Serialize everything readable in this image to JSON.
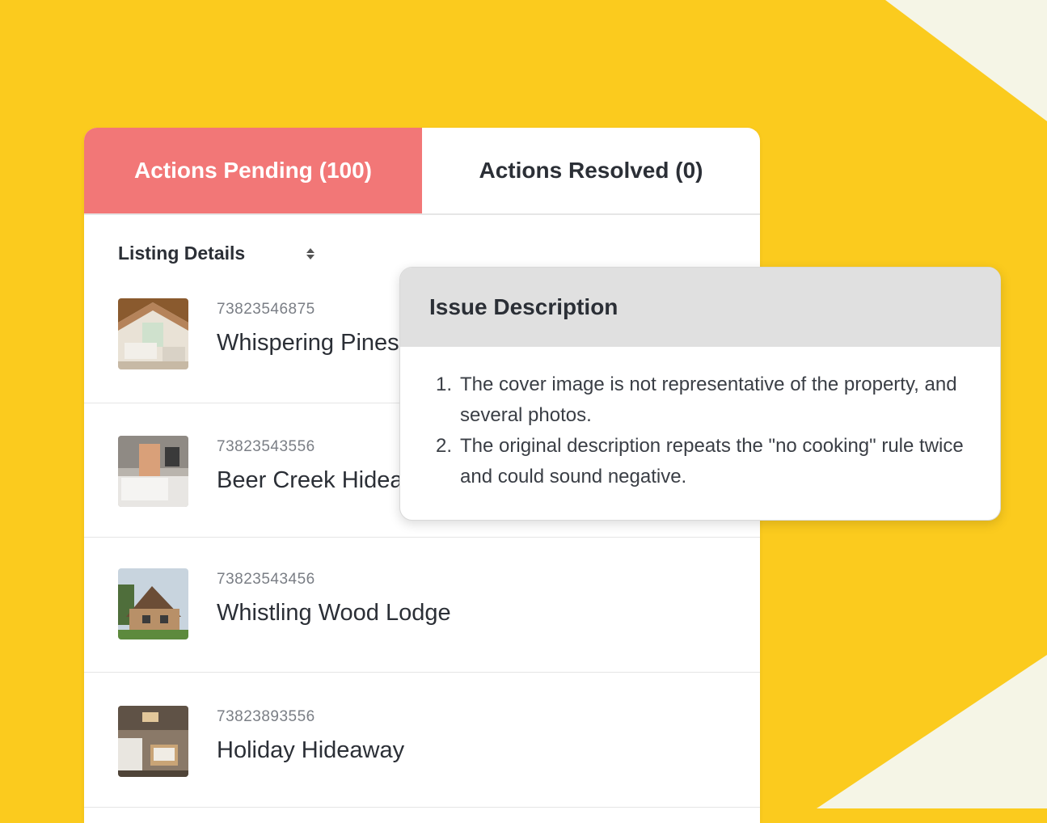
{
  "tabs": {
    "pending": "Actions Pending (100)",
    "resolved": "Actions Resolved (0)"
  },
  "list": {
    "header": "Listing Details",
    "items": [
      {
        "id": "73823546875",
        "name": "Whispering Pines"
      },
      {
        "id": "73823543556",
        "name": "Beer Creek Hidea"
      },
      {
        "id": "73823543456",
        "name": "Whistling Wood Lodge"
      },
      {
        "id": "73823893556",
        "name": "Holiday Hideaway"
      }
    ]
  },
  "popup": {
    "title": "Issue Description",
    "issues": [
      {
        "num": "1.",
        "text": "The cover image is not representative of the property, and several photos."
      },
      {
        "num": "2.",
        "text": "The original description repeats the \"no cooking\" rule twice and could sound negative."
      }
    ]
  },
  "colors": {
    "background": "#fbcb1e",
    "accent_tab": "#f27777",
    "corner": "#f5f5e6"
  },
  "icons": [
    "sort-icon"
  ]
}
